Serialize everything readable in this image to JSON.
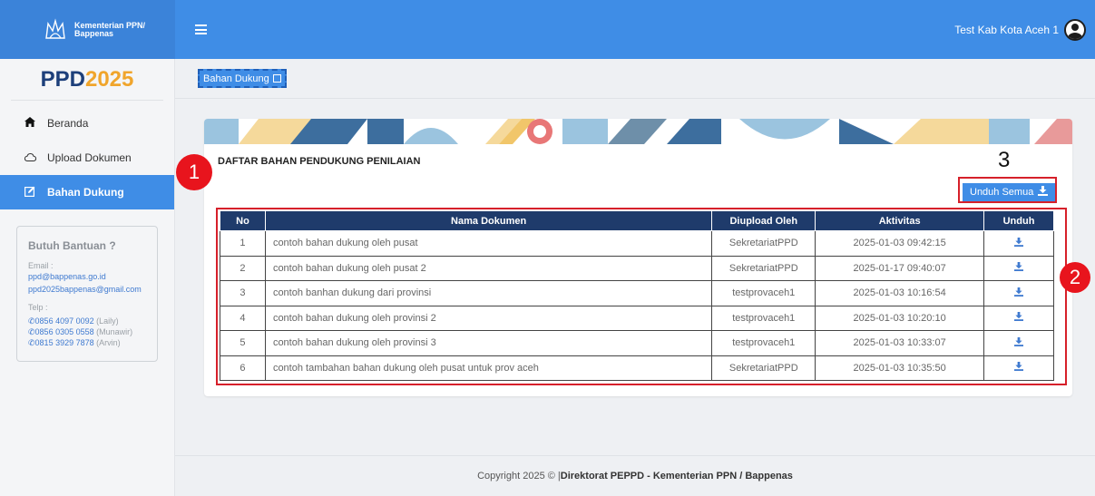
{
  "header": {
    "brand_line1": "Kementerian PPN/",
    "brand_line2": "Bappenas",
    "user_name": "Test Kab Kota Aceh 1",
    "accent": "#3f8de6"
  },
  "sidebar": {
    "title_part1": "PPD",
    "title_part2": "2025",
    "items": [
      {
        "label": "Beranda",
        "icon": "home-icon"
      },
      {
        "label": "Upload Dokumen",
        "icon": "cloud-icon"
      },
      {
        "label": "Bahan Dukung",
        "icon": "edit-icon"
      }
    ],
    "help": {
      "title": "Butuh Bantuan ?",
      "email_label": "Email :",
      "email_1": "ppd@bappenas.go.id",
      "email_2": "ppd2025bappenas@gmail.com",
      "phone_label": "Telp :",
      "phones": [
        {
          "number": "0856 4097 0092",
          "name": "(Laily)"
        },
        {
          "number": "0856 0305 0558",
          "name": "(Munawir)"
        },
        {
          "number": "0815 3929 7878",
          "name": "(Arvin)"
        }
      ]
    }
  },
  "breadcrumb": {
    "label": "Bahan Dukung"
  },
  "card": {
    "title": "DAFTAR BAHAN PENDUKUNG PENILAIAN",
    "download_all": "Unduh Semua",
    "columns": [
      "No",
      "Nama Dokumen",
      "Diupload Oleh",
      "Aktivitas",
      "Unduh"
    ],
    "rows": [
      {
        "no": "1",
        "name": "contoh bahan dukung oleh pusat",
        "by": "SekretariatPPD",
        "time": "2025-01-03 09:42:15"
      },
      {
        "no": "2",
        "name": "contoh bahan dukung oleh pusat 2",
        "by": "SekretariatPPD",
        "time": "2025-01-17 09:40:07"
      },
      {
        "no": "3",
        "name": "contoh banhan dukung dari provinsi",
        "by": "testprovaceh1",
        "time": "2025-01-03 10:16:54"
      },
      {
        "no": "4",
        "name": "contoh bahan dukung oleh provinsi 2",
        "by": "testprovaceh1",
        "time": "2025-01-03 10:20:10"
      },
      {
        "no": "5",
        "name": "contoh bahan dukung oleh provinsi 3",
        "by": "testprovaceh1",
        "time": "2025-01-03 10:33:07"
      },
      {
        "no": "6",
        "name": "contoh tambahan bahan dukung oleh pusat untuk prov aceh",
        "by": "SekretariatPPD",
        "time": "2025-01-03 10:35:50"
      }
    ]
  },
  "annotations": {
    "n1": "1",
    "n2": "2",
    "n3": "3"
  },
  "footer": {
    "prefix": "Copyright 2025 © |",
    "strong": "Direktorat PEPPD - Kementerian PPN / Bappenas"
  }
}
